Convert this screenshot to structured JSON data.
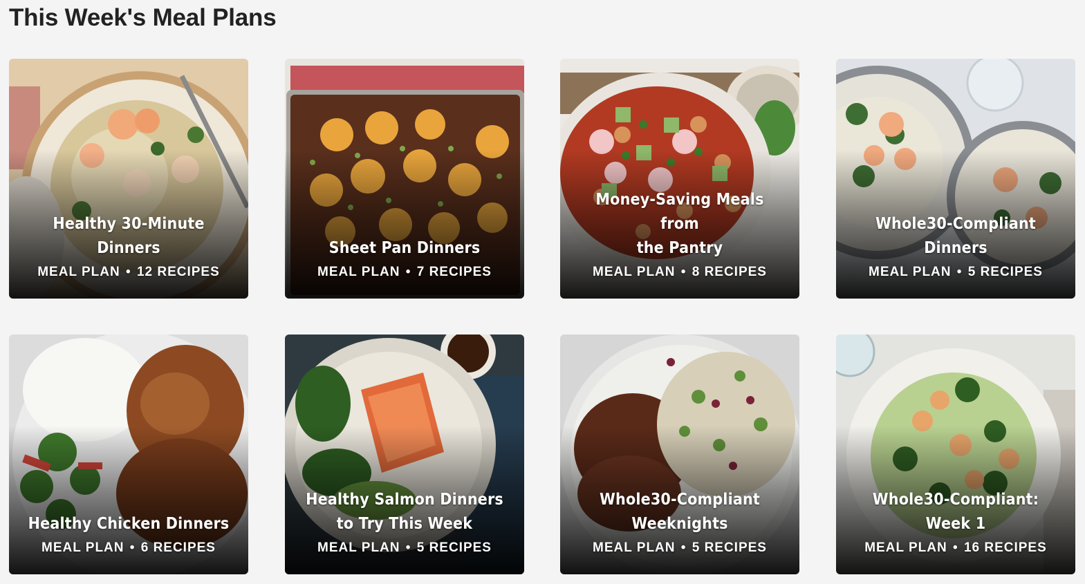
{
  "page": {
    "title": "This Week's Meal Plans"
  },
  "cards": [
    {
      "title_line1": "Healthy 30-Minute",
      "title_line2": "Dinners",
      "type": "MEAL PLAN",
      "separator": "•",
      "recipes": "12 RECIPES",
      "image": "shrimp-orzo-plate"
    },
    {
      "title_line1": "",
      "title_line2": "Sheet Pan Dinners",
      "type": "MEAL PLAN",
      "separator": "•",
      "recipes": "7 RECIPES",
      "image": "sheet-pan-cornbread-casserole"
    },
    {
      "title_line1": "Money-Saving Meals from",
      "title_line2": "the Pantry",
      "type": "MEAL PLAN",
      "separator": "•",
      "recipes": "8 RECIPES",
      "image": "chickpea-stew-bowl"
    },
    {
      "title_line1": "Whole30-Compliant",
      "title_line2": "Dinners",
      "type": "MEAL PLAN",
      "separator": "•",
      "recipes": "5 RECIPES",
      "image": "shrimp-cauliflower-rice-bowls"
    },
    {
      "title_line1": "",
      "title_line2": "Healthy Chicken Dinners",
      "type": "MEAL PLAN",
      "separator": "•",
      "recipes": "6 RECIPES",
      "image": "chicken-rice-broccoli-plate"
    },
    {
      "title_line1": "Healthy Salmon Dinners",
      "title_line2": "to Try This Week",
      "type": "MEAL PLAN",
      "separator": "•",
      "recipes": "5 RECIPES",
      "image": "salmon-bok-choy-plate"
    },
    {
      "title_line1": "Whole30-Compliant",
      "title_line2": "Weeknights",
      "type": "MEAL PLAN",
      "separator": "•",
      "recipes": "5 RECIPES",
      "image": "steak-cauliflower-rice-plate"
    },
    {
      "title_line1": "Whole30-Compliant:",
      "title_line2": "Week 1",
      "type": "MEAL PLAN",
      "separator": "•",
      "recipes": "16 RECIPES",
      "image": "shrimp-broccoli-plate"
    }
  ]
}
